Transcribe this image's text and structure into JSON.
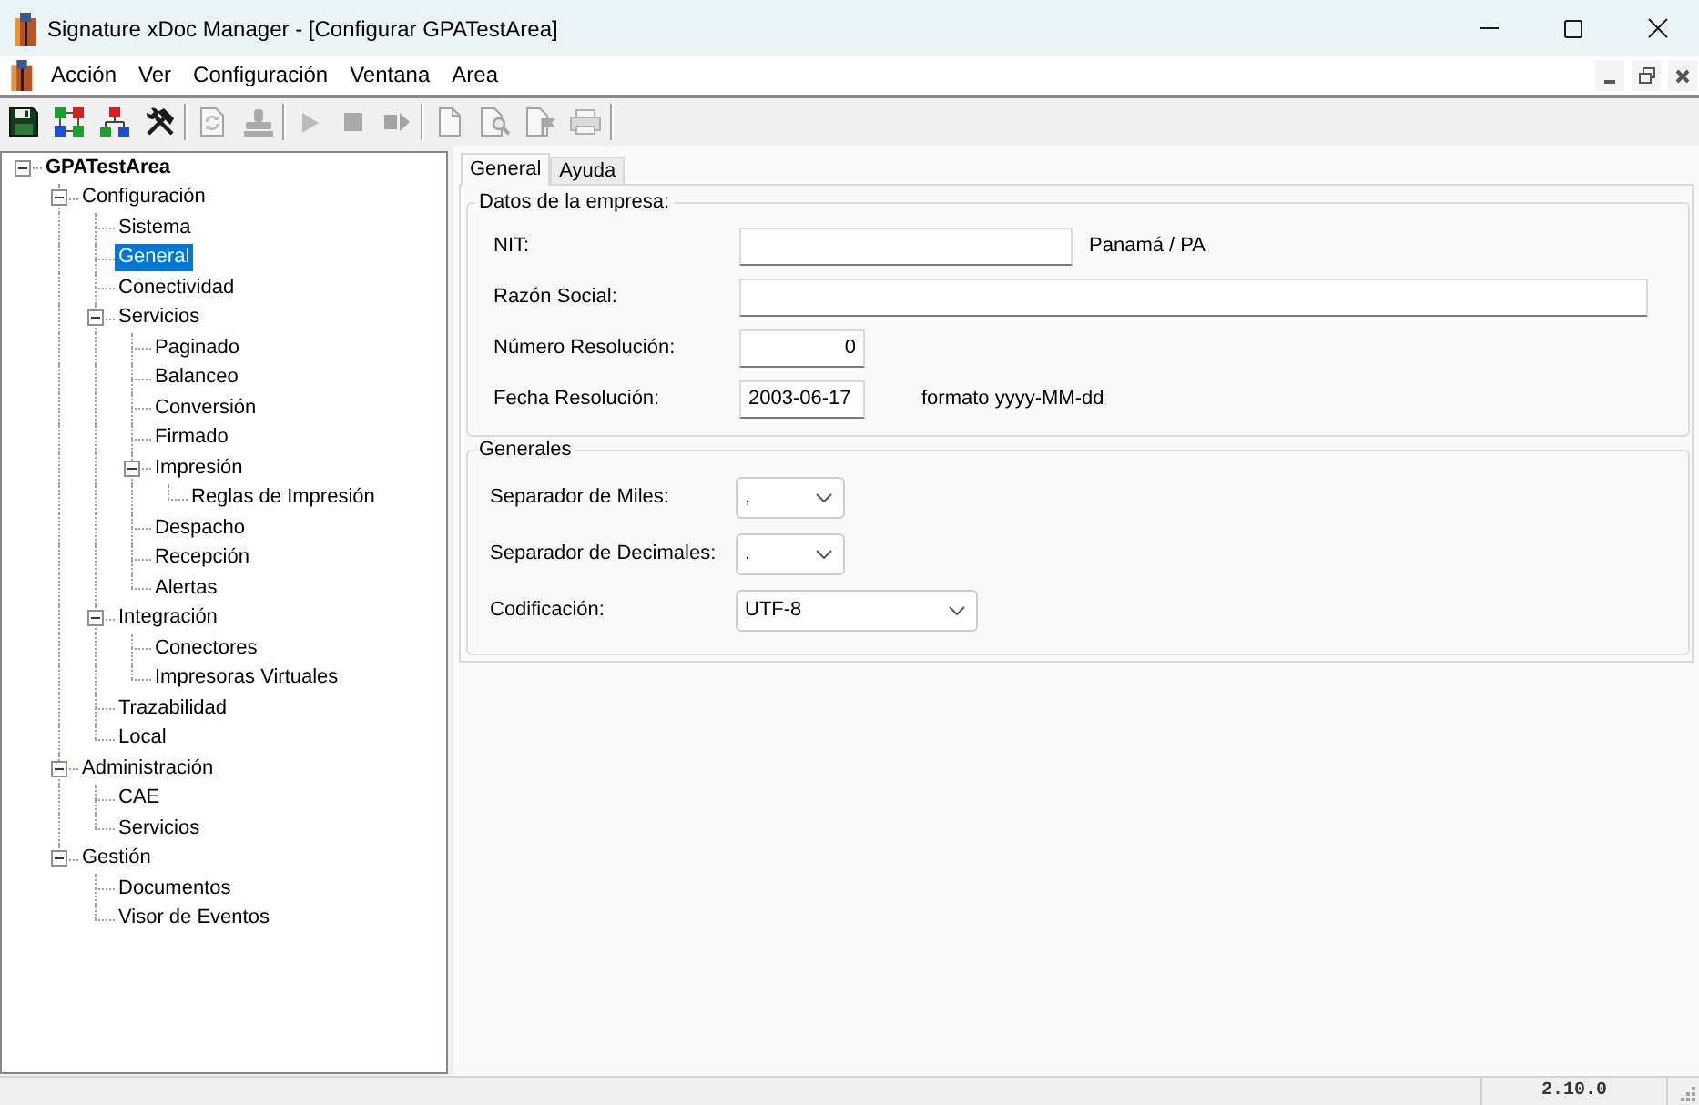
{
  "window": {
    "title": "Signature xDoc Manager - [Configurar GPATestArea]"
  },
  "menu_bar": {
    "items": [
      "Acción",
      "Ver",
      "Configuración",
      "Ventana",
      "Area"
    ]
  },
  "toolbar": {
    "groups": [
      {
        "buttons": [
          {
            "disabled": false
          },
          {
            "disabled": false
          },
          {
            "disabled": false
          },
          {
            "disabled": false
          }
        ]
      },
      {
        "buttons": [
          {
            "disabled": true
          },
          {
            "disabled": true
          }
        ]
      },
      {
        "buttons": [
          {
            "disabled": true
          },
          {
            "disabled": true
          },
          {
            "disabled": true
          }
        ]
      },
      {
        "buttons": [
          {
            "disabled": true
          },
          {
            "disabled": true
          },
          {
            "disabled": true
          },
          {
            "disabled": true
          }
        ]
      }
    ]
  },
  "tree": {
    "items": [
      {
        "label": "GPATestArea",
        "selected": false,
        "expanded": true,
        "children": [
          {
            "label": "Configuración",
            "selected": false,
            "expanded": true,
            "children": [
              {
                "label": "Sistema",
                "selected": false
              },
              {
                "label": "General",
                "selected": true
              },
              {
                "label": "Conectividad",
                "selected": false
              },
              {
                "label": "Servicios",
                "selected": false,
                "expanded": true,
                "children": [
                  {
                    "label": "Paginado",
                    "selected": false
                  },
                  {
                    "label": "Balanceo",
                    "selected": false
                  },
                  {
                    "label": "Conversión",
                    "selected": false
                  },
                  {
                    "label": "Firmado",
                    "selected": false
                  },
                  {
                    "label": "Impresión",
                    "selected": false,
                    "expanded": true,
                    "children": [
                      {
                        "label": "Reglas de Impresión",
                        "selected": false
                      }
                    ]
                  },
                  {
                    "label": "Despacho",
                    "selected": false
                  },
                  {
                    "label": "Recepción",
                    "selected": false
                  },
                  {
                    "label": "Alertas",
                    "selected": false
                  }
                ]
              },
              {
                "label": "Integración",
                "selected": false,
                "expanded": true,
                "children": [
                  {
                    "label": "Conectores",
                    "selected": false
                  },
                  {
                    "label": "Impresoras Virtuales",
                    "selected": false
                  }
                ]
              },
              {
                "label": "Trazabilidad",
                "selected": false
              },
              {
                "label": "Local",
                "selected": false
              }
            ]
          },
          {
            "label": "Administración",
            "selected": false,
            "expanded": true,
            "children": [
              {
                "label": "CAE",
                "selected": false
              },
              {
                "label": "Servicios",
                "selected": false
              }
            ]
          },
          {
            "label": "Gestión",
            "selected": false,
            "expanded": true,
            "children": [
              {
                "label": "Documentos",
                "selected": false
              },
              {
                "label": "Visor de Eventos",
                "selected": false
              }
            ]
          }
        ]
      }
    ]
  },
  "tabs": [
    {
      "label": "General",
      "selected": true
    },
    {
      "label": "Ayuda",
      "selected": false
    }
  ],
  "groups": [
    {
      "title": "Datos de la empresa:",
      "fields": [
        {
          "kind": "text",
          "label": "NIT:",
          "note": "Panamá / PA"
        },
        {
          "kind": "text",
          "label": "Razón Social:"
        },
        {
          "kind": "number",
          "label": "Número Resolución:",
          "value": "0"
        },
        {
          "kind": "date",
          "label": "Fecha Resolución:",
          "value": "2003-06-17",
          "note": "formato yyyy-MM-dd"
        }
      ]
    },
    {
      "title": "Generales",
      "fields": [
        {
          "kind": "select",
          "label": "Separador de Miles:",
          "value": ","
        },
        {
          "kind": "select",
          "label": "Separador de Decimales:",
          "value": "."
        },
        {
          "kind": "select",
          "label": "Codificación:",
          "value": "UTF-8"
        }
      ]
    }
  ],
  "status_bar": {
    "text": "2.10.0"
  }
}
